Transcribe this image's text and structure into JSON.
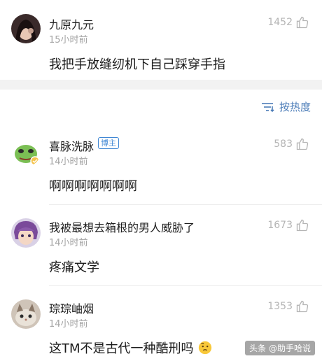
{
  "comments": [
    {
      "name": "九原九元",
      "time": "15小时前",
      "likes": "1452",
      "text": "我把手放缝纫机下自己踩穿手指"
    },
    {
      "name": "喜脉洗脉",
      "badge": "博主",
      "time": "14小时前",
      "likes": "583",
      "text": "啊啊啊啊啊啊啊"
    },
    {
      "name": "我被最想去箱根的男人威胁了",
      "time": "14小时前",
      "likes": "1673",
      "text": "疼痛文学"
    },
    {
      "name": "琮琮岫烟",
      "time": "14小时前",
      "likes": "1353",
      "text": "这TM不是古代一种酷刑吗"
    }
  ],
  "sort": {
    "label": "按热度"
  },
  "watermark": "头条 @助手哈说",
  "colors": {
    "accent": "#4d7db8",
    "muted": "#a3a3a3",
    "badge": "#3f87d4"
  }
}
